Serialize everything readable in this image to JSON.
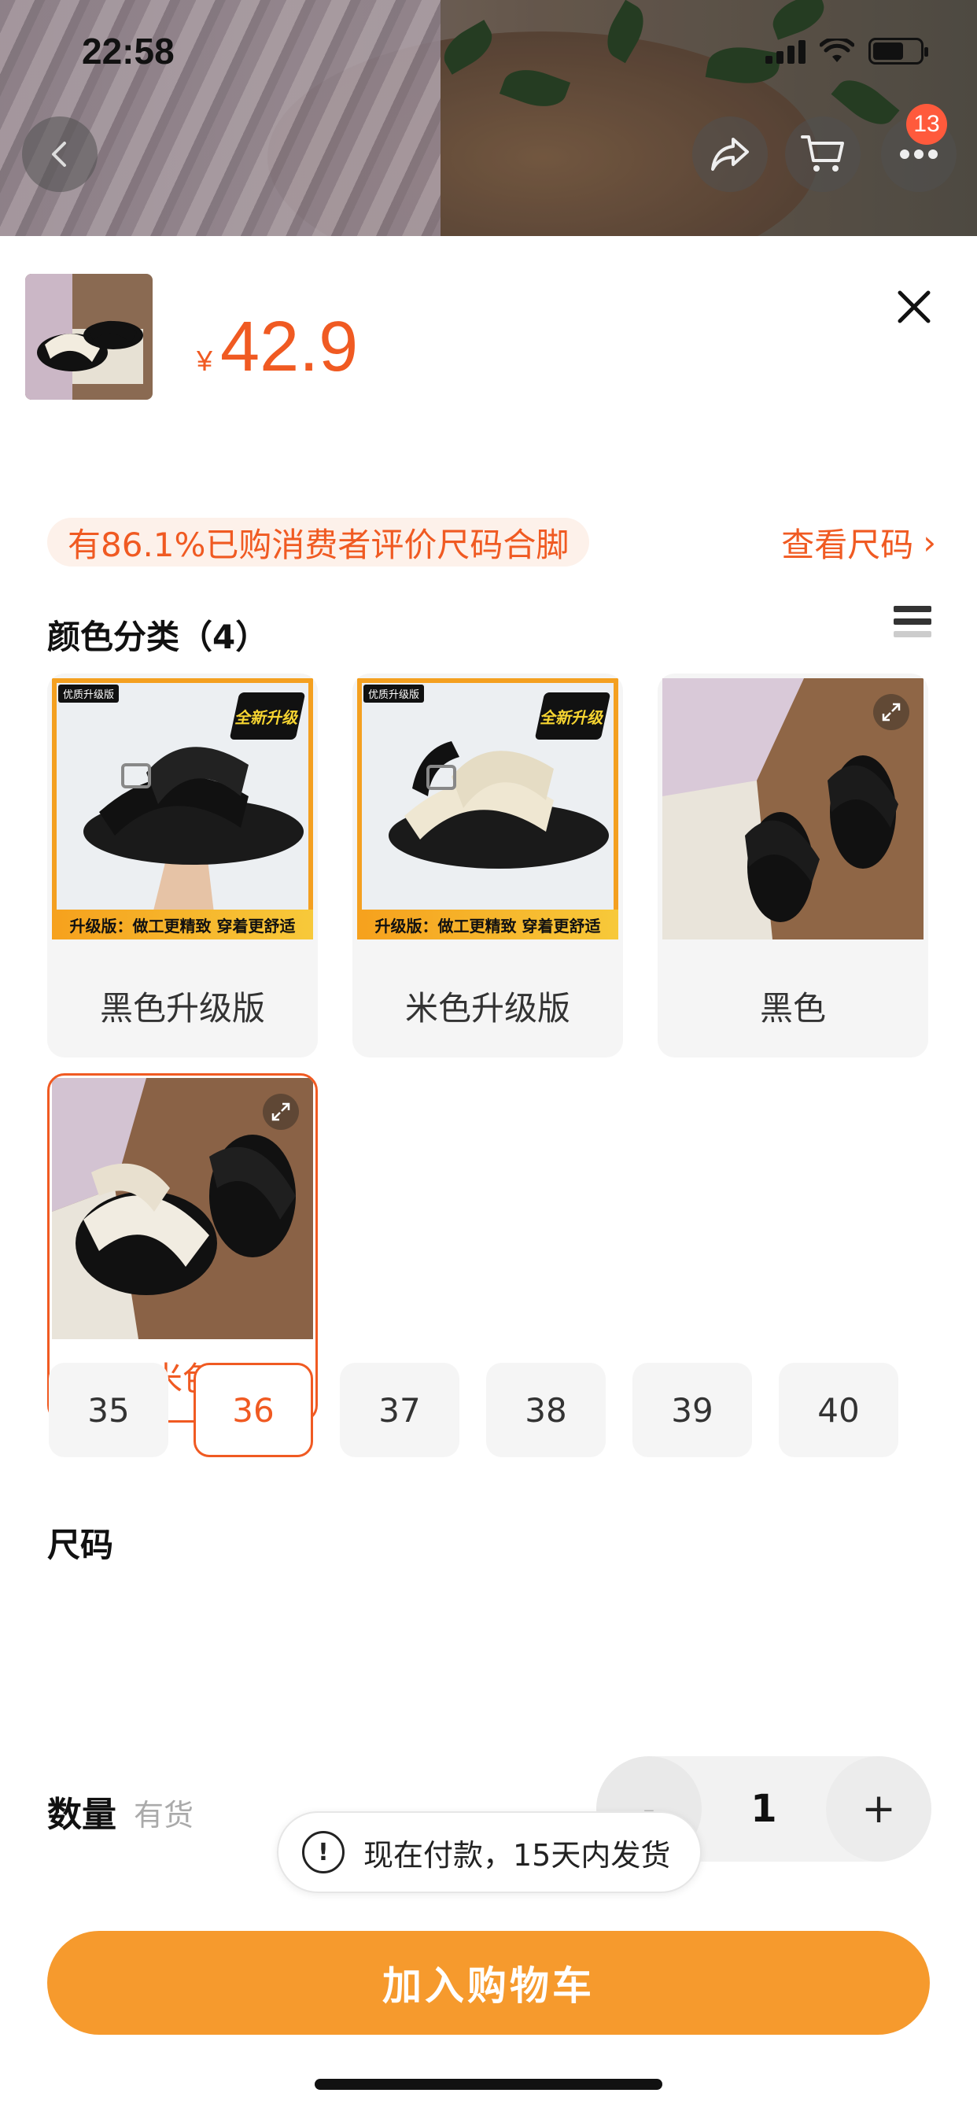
{
  "status_bar": {
    "time": "22:58"
  },
  "header": {
    "cart_badge": "13"
  },
  "product": {
    "currency": "¥",
    "price": "42.9",
    "fit_note": "有86.1%已购消费者评价尺码合脚",
    "size_chart_link": "查看尺码",
    "link_chevron": "›"
  },
  "colors": {
    "title": "颜色分类（4）",
    "options": [
      {
        "label": "黑色升级版",
        "selected": false
      },
      {
        "label": "米色升级版",
        "selected": false
      },
      {
        "label": "黑色",
        "selected": false
      },
      {
        "label": "米色",
        "selected": true
      }
    ],
    "upgrade_tag": "优质升级版",
    "upgrade_banner": "升级版：做工更精致  穿着更舒适",
    "upgrade_star": "全新升级"
  },
  "sizes": {
    "title": "尺码",
    "options": [
      "35",
      "36",
      "37",
      "38",
      "39",
      "40"
    ],
    "selected": "36"
  },
  "quantity": {
    "label": "数量",
    "stock": "有货",
    "minus": "-",
    "value": "1",
    "plus": "+"
  },
  "toast": {
    "icon": "!",
    "text": "现在付款，15天内发货"
  },
  "cta": {
    "label": "加入购物车"
  },
  "theme": {
    "accent": "#f05a22",
    "cta": "#f69a2d"
  }
}
